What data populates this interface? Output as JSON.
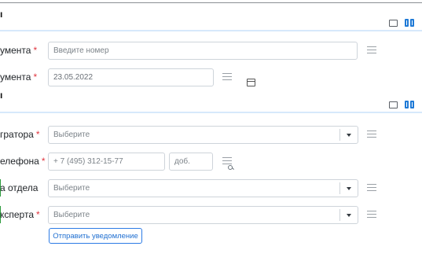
{
  "section1": {
    "heading_fragment": "ı",
    "fields": [
      {
        "label": "умента",
        "required": "*",
        "placeholder": "Введите номер"
      },
      {
        "label": "умента",
        "required": "*",
        "value": "23.05.2022"
      }
    ]
  },
  "section2": {
    "heading_fragment": "ı",
    "fields": [
      {
        "label": "гратора",
        "required": "*",
        "placeholder": "Выберите"
      },
      {
        "label": "елефона",
        "required": "*",
        "phone_placeholder": "+ 7 (495) 312-15-77",
        "ext_placeholder": "доб."
      },
      {
        "label": "а отдела",
        "placeholder": "Выберите"
      },
      {
        "label": "ксперта",
        "required": "*",
        "placeholder": "Выберите"
      }
    ],
    "notify_button": "Отправить уведомление"
  },
  "colors": {
    "accent": "#1f7ad6",
    "required": "#e0353f",
    "separator": "#d7e9fb"
  },
  "icons": [
    "single-column-icon",
    "two-columns-icon",
    "list-icon",
    "calendar-icon",
    "search-icon",
    "caret-down-icon"
  ]
}
